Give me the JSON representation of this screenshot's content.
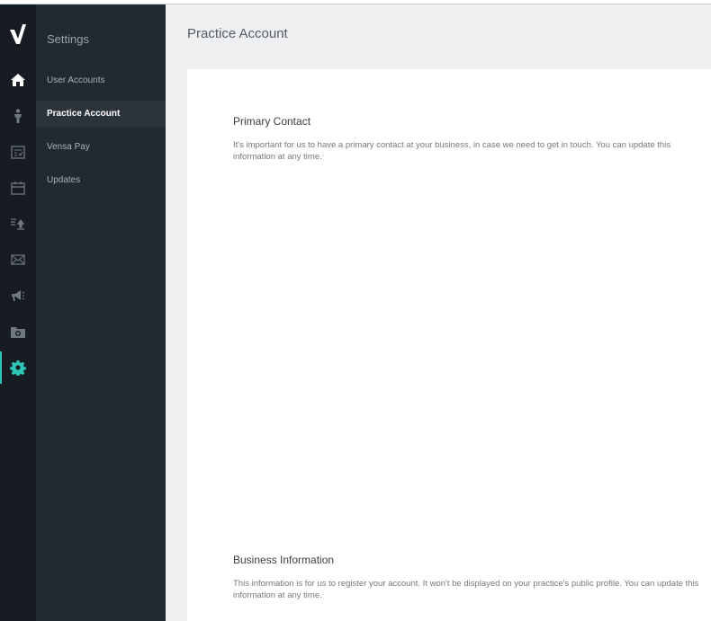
{
  "sidebar": {
    "title": "Settings",
    "items": [
      {
        "label": "User Accounts"
      },
      {
        "label": "Practice Account"
      },
      {
        "label": "Vensa Pay"
      },
      {
        "label": "Updates"
      }
    ],
    "active_item": "Practice Account"
  },
  "rail": {
    "icons": [
      "vensa-logo-icon",
      "home-icon",
      "person-icon",
      "checklist-icon",
      "calendar-icon",
      "list-upload-icon",
      "envelope-icon",
      "megaphone-icon",
      "folder-add-icon",
      "gear-icon"
    ],
    "active_icon": "gear-icon"
  },
  "main": {
    "title": "Practice Account",
    "sections": [
      {
        "title": "Primary Contact",
        "description": "It's important for us to have a primary contact at your business, in case we need to get in touch. You can update this information at any time."
      },
      {
        "title": "Business Information",
        "description": "This information is for us to register your account. It won't be displayed on your practice's public profile. You can update this information at any time."
      }
    ]
  },
  "colors": {
    "rail_bg": "#161c22",
    "subnav_bg": "#212931",
    "active_item_bg": "#2b333b",
    "accent": "#2ec4b6",
    "main_bg": "#eef0f2"
  }
}
